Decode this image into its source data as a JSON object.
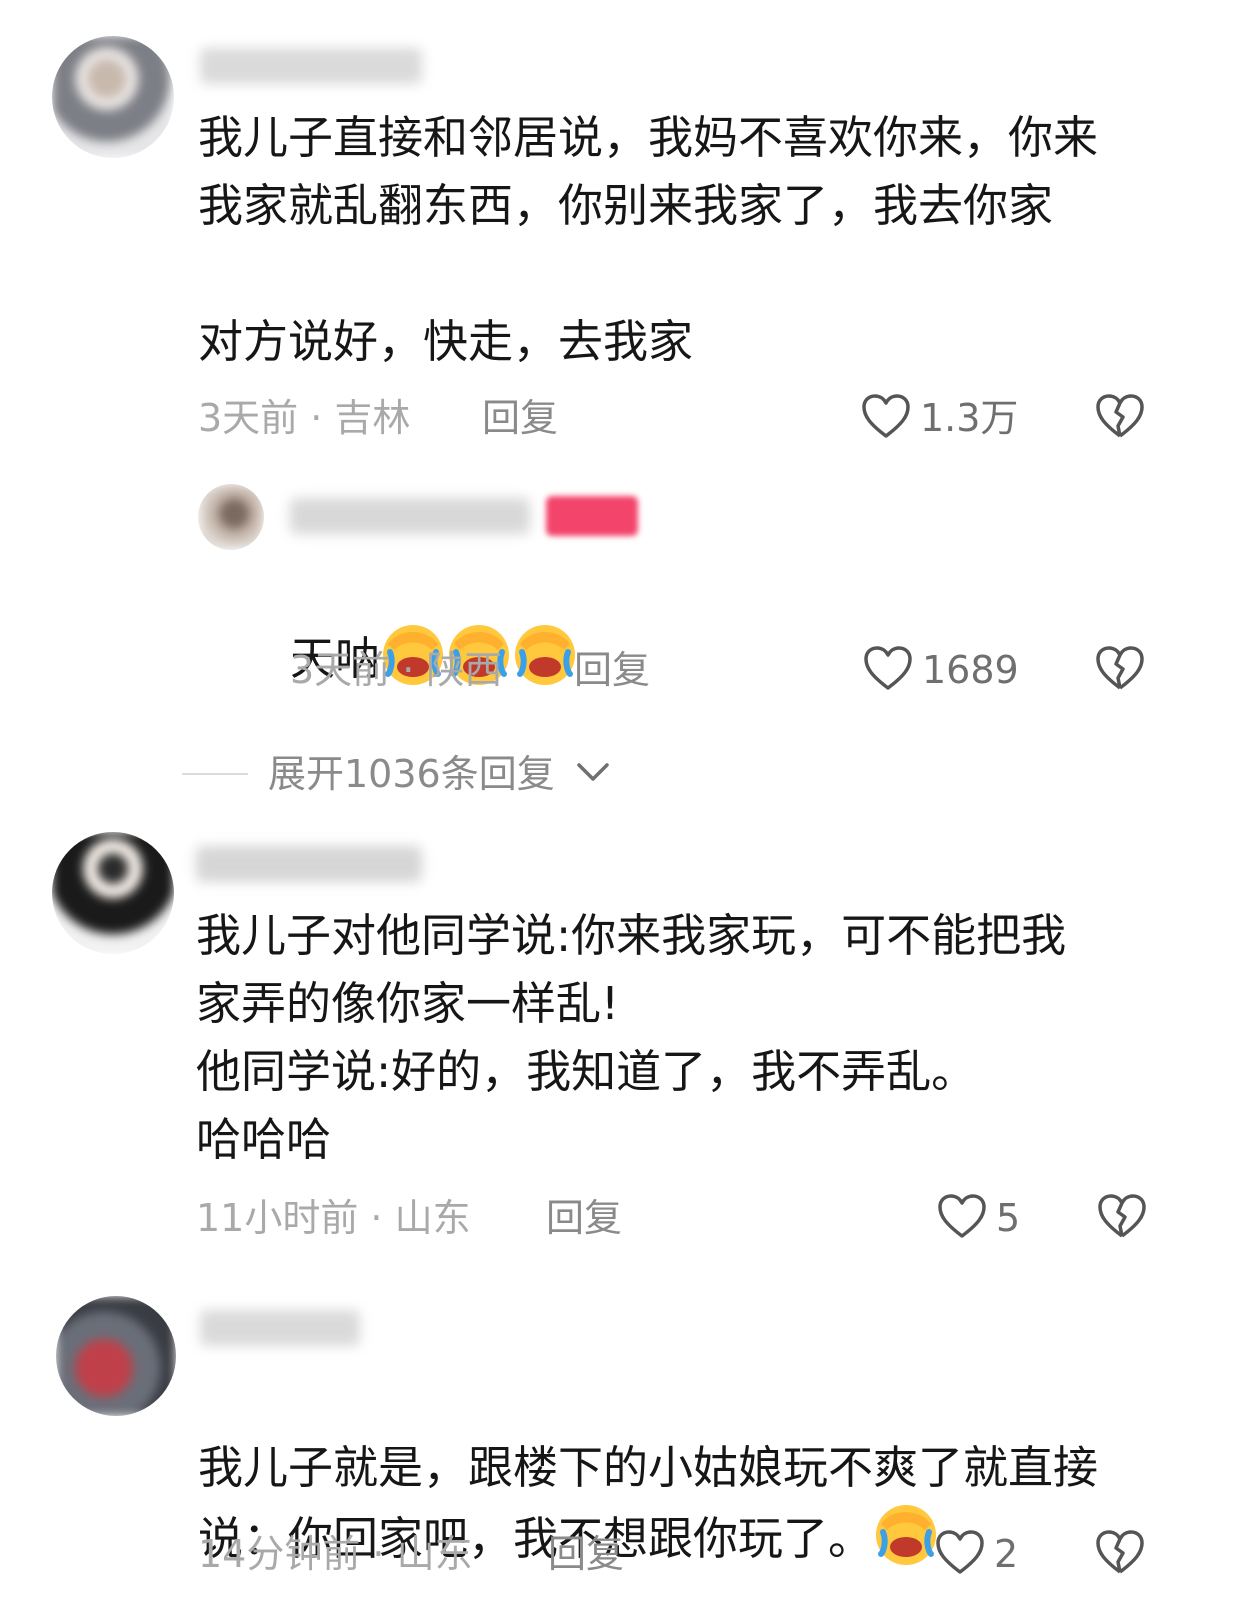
{
  "colors": {
    "text": "#161616",
    "meta": "#a9a9a9",
    "reply": "#8a8a8a",
    "like_icon": "#555555",
    "author_tag": "#f3446b"
  },
  "comments": [
    {
      "text": "我儿子直接和邻居说，我妈不喜欢你来，你来\n我家就乱翻东西，你别来我家了，我去你家\n\n对方说好，快走，去我家",
      "time": "3天前 · 吉林",
      "reply_label": "回复",
      "likes": "1.3万"
    },
    {
      "text": "天呐",
      "emoji_count": 3,
      "emoji_icon": "facepalm-crying-emoji",
      "time": "3天前 · 陕西",
      "reply_label": "回复",
      "likes": "1689"
    },
    {
      "text": "我儿子对他同学说:你来我家玩，可不能把我\n家弄的像你家一样乱!\n他同学说:好的，我知道了，我不弄乱。\n哈哈哈",
      "time": "11小时前 · 山东",
      "reply_label": "回复",
      "likes": "5"
    },
    {
      "text": "我儿子就是，跟楼下的小姑娘玩不爽了就直接\n说：你回家吧，我不想跟你玩了。",
      "emoji_icon": "facepalm-crying-emoji",
      "time": "14分钟前 · 山东",
      "reply_label": "回复",
      "likes": "2"
    }
  ],
  "expand_replies": "展开1036条回复",
  "icons": {
    "like": "heart-outline-icon",
    "dislike": "broken-heart-icon",
    "expand": "chevron-down-icon"
  }
}
